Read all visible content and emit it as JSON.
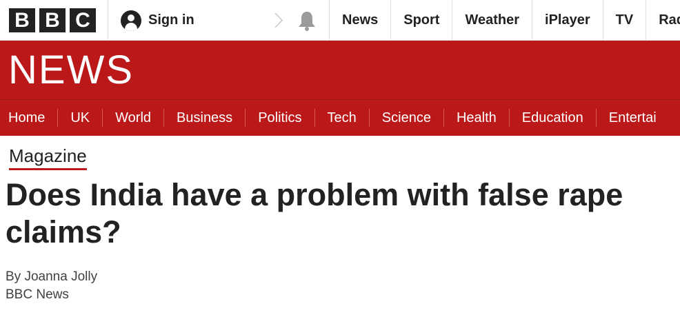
{
  "brand": {
    "letters": [
      "B",
      "B",
      "C"
    ]
  },
  "account": {
    "signin_label": "Sign in"
  },
  "global_nav": [
    "News",
    "Sport",
    "Weather",
    "iPlayer",
    "TV",
    "Rad"
  ],
  "banner": {
    "title": "NEWS"
  },
  "section_nav": [
    "Home",
    "UK",
    "World",
    "Business",
    "Politics",
    "Tech",
    "Science",
    "Health",
    "Education",
    "Entertai"
  ],
  "article": {
    "section": "Magazine",
    "headline": "Does India have a problem with false rape claims?",
    "byline": "By Joanna Jolly",
    "source": "BBC News"
  },
  "colors": {
    "brand_red": "#bb1919",
    "text_dark": "#222222"
  },
  "icons": [
    "user-icon",
    "bell-icon",
    "chevron-right-icon"
  ]
}
